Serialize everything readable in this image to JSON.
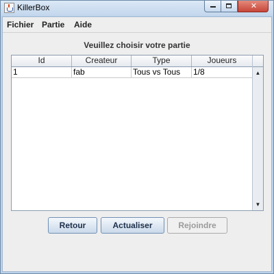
{
  "window": {
    "title": "KillerBox",
    "controls": {
      "minimize_icon": "minimize-icon",
      "maximize_icon": "maximize-icon",
      "close_label": "✕"
    }
  },
  "menubar": {
    "items": [
      {
        "label": "Fichier"
      },
      {
        "label": "Partie"
      },
      {
        "label": "Aide"
      }
    ]
  },
  "main": {
    "heading": "Veuillez choisir votre partie",
    "table": {
      "columns": [
        "Id",
        "Createur",
        "Type",
        "Joueurs"
      ],
      "rows": [
        {
          "id": "1",
          "createur": "fab",
          "type": "Tous vs Tous",
          "joueurs": "1/8"
        }
      ]
    },
    "scrollbar": {
      "up_icon": "▲",
      "down_icon": "▼"
    }
  },
  "buttons": {
    "retour": "Retour",
    "actualiser": "Actualiser",
    "rejoindre": "Rejoindre"
  }
}
